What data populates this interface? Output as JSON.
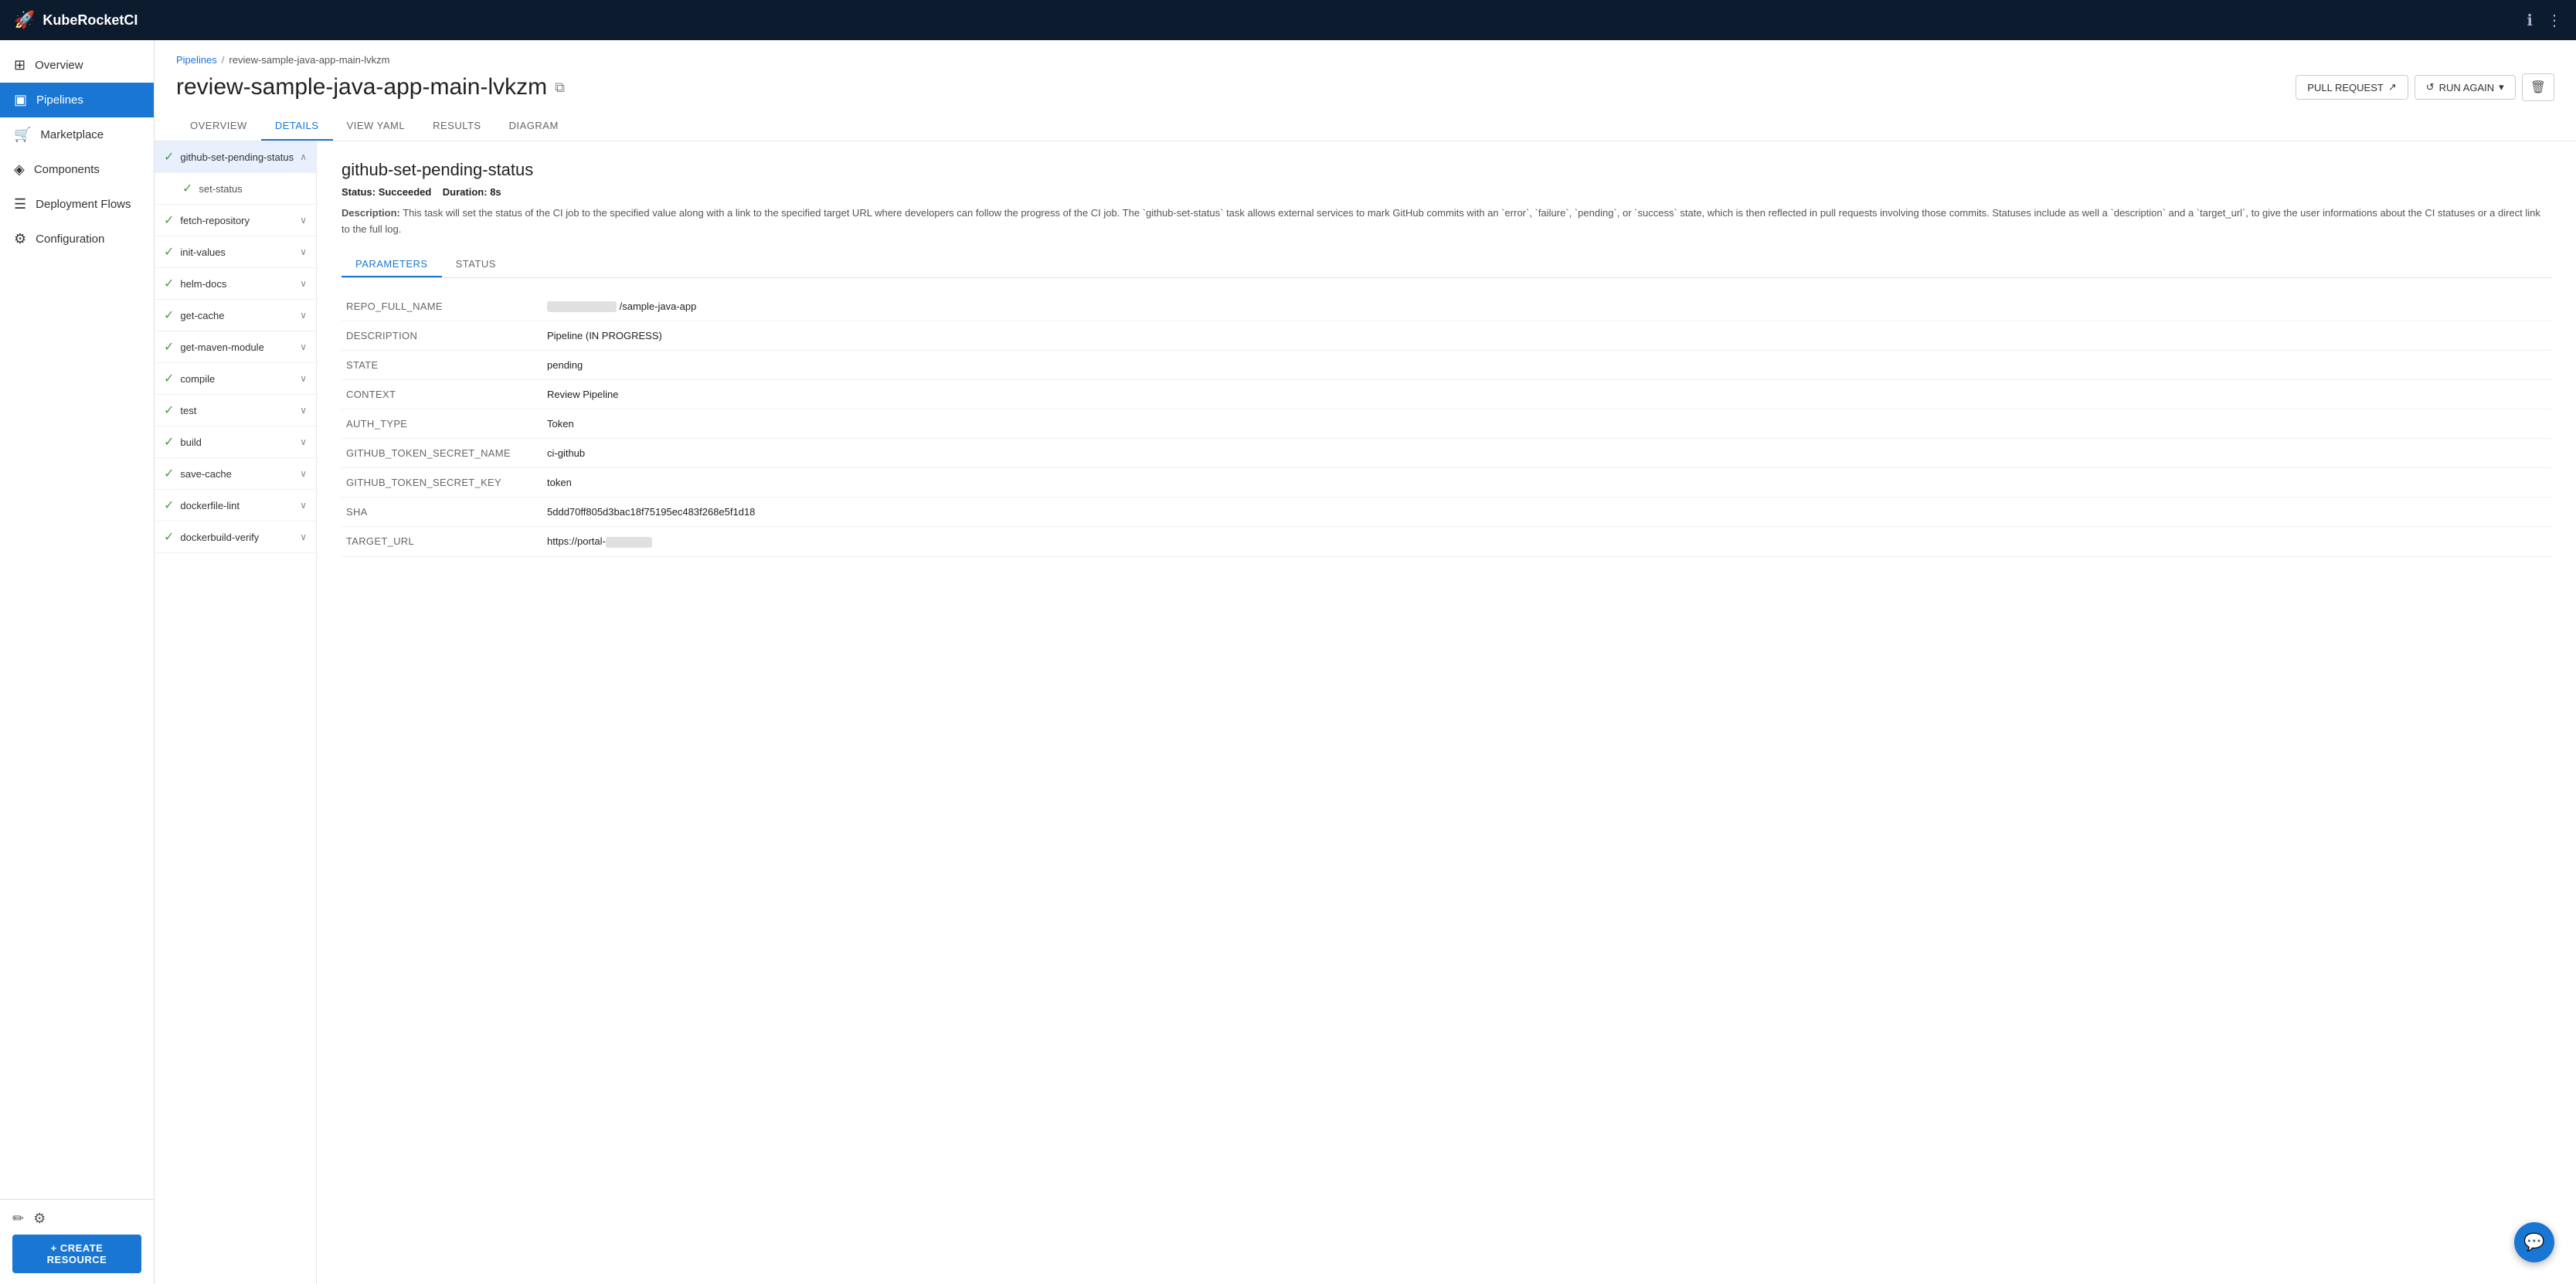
{
  "app": {
    "title": "KubeRocketCI",
    "logo": "🚀"
  },
  "topnav": {
    "info_icon": "ℹ",
    "more_icon": "⋮"
  },
  "sidebar": {
    "collapse_icon": "‹",
    "items": [
      {
        "id": "overview",
        "label": "Overview",
        "icon": "⊞"
      },
      {
        "id": "pipelines",
        "label": "Pipelines",
        "icon": "▣",
        "active": true
      },
      {
        "id": "marketplace",
        "label": "Marketplace",
        "icon": "🛒"
      },
      {
        "id": "components",
        "label": "Components",
        "icon": "◈"
      },
      {
        "id": "deployment-flows",
        "label": "Deployment Flows",
        "icon": "☰"
      },
      {
        "id": "configuration",
        "label": "Configuration",
        "icon": "⚙"
      }
    ],
    "bottom": {
      "edit_icon": "✏",
      "settings_icon": "⚙",
      "create_resource_label": "+ CREATE RESOURCE"
    }
  },
  "breadcrumb": {
    "link_text": "Pipelines",
    "separator": "/",
    "current": "review-sample-java-app-main-lvkzm"
  },
  "page": {
    "title": "review-sample-java-app-main-lvkzm",
    "copy_icon": "⧉",
    "actions": {
      "pull_request": "PULL REQUEST",
      "pull_request_icon": "↗",
      "run_again": "RUN AGAIN",
      "run_again_icon": "↺",
      "dropdown_icon": "▾",
      "delete_icon": "🗑"
    }
  },
  "tabs": [
    {
      "id": "overview",
      "label": "OVERVIEW"
    },
    {
      "id": "details",
      "label": "DETAILS",
      "active": true
    },
    {
      "id": "view-yaml",
      "label": "VIEW YAML"
    },
    {
      "id": "results",
      "label": "RESULTS"
    },
    {
      "id": "diagram",
      "label": "DIAGRAM"
    }
  ],
  "pipeline_steps": [
    {
      "id": "github-set-pending-status",
      "label": "github-set-pending-status",
      "status": "✓",
      "expanded": true,
      "selected": true,
      "has_chevron": true
    },
    {
      "id": "set-status",
      "label": "set-status",
      "status": "✓",
      "sub": true
    },
    {
      "id": "fetch-repository",
      "label": "fetch-repository",
      "status": "✓",
      "has_chevron": true
    },
    {
      "id": "init-values",
      "label": "init-values",
      "status": "✓",
      "has_chevron": true
    },
    {
      "id": "helm-docs",
      "label": "helm-docs",
      "status": "✓",
      "has_chevron": true
    },
    {
      "id": "get-cache",
      "label": "get-cache",
      "status": "✓",
      "has_chevron": true
    },
    {
      "id": "get-maven-module",
      "label": "get-maven-module",
      "status": "✓",
      "has_chevron": true
    },
    {
      "id": "compile",
      "label": "compile",
      "status": "✓",
      "has_chevron": true
    },
    {
      "id": "test",
      "label": "test",
      "status": "✓",
      "has_chevron": true
    },
    {
      "id": "build",
      "label": "build",
      "status": "✓",
      "has_chevron": true
    },
    {
      "id": "save-cache",
      "label": "save-cache",
      "status": "✓",
      "has_chevron": true
    },
    {
      "id": "dockerfile-lint",
      "label": "dockerfile-lint",
      "status": "✓",
      "has_chevron": true
    },
    {
      "id": "dockerbuild-verify",
      "label": "dockerbuild-verify",
      "status": "✓",
      "has_chevron": true
    }
  ],
  "detail": {
    "title": "github-set-pending-status",
    "status_label": "Status:",
    "status_value": "Succeeded",
    "duration_label": "Duration:",
    "duration_value": "8s",
    "description_label": "Description:",
    "description": "This task will set the status of the CI job to the specified value along with a link to the specified target URL where developers can follow the progress of the CI job. The `github-set-status` task allows external services to mark GitHub commits with an `error`, `failure`, `pending`, or `success` state, which is then reflected in pull requests involving those commits. Statuses include as well a `description` and a `target_url`, to give the user informations about the CI statuses or a direct link to the full log.",
    "inner_tabs": [
      {
        "id": "parameters",
        "label": "PARAMETERS",
        "active": true
      },
      {
        "id": "status",
        "label": "STATUS"
      }
    ],
    "parameters": [
      {
        "key": "REPO_FULL_NAME",
        "value": "/sample-java-app",
        "redacted": true
      },
      {
        "key": "DESCRIPTION",
        "value": "Pipeline (IN PROGRESS)",
        "redacted": false
      },
      {
        "key": "STATE",
        "value": "pending",
        "redacted": false
      },
      {
        "key": "CONTEXT",
        "value": "Review Pipeline",
        "redacted": false
      },
      {
        "key": "AUTH_TYPE",
        "value": "Token",
        "redacted": false
      },
      {
        "key": "GITHUB_TOKEN_SECRET_NAME",
        "value": "ci-github",
        "redacted": false
      },
      {
        "key": "GITHUB_TOKEN_SECRET_KEY",
        "value": "token",
        "redacted": false
      },
      {
        "key": "SHA",
        "value": "5ddd70ff805d3bac18f75195ec483f268e5f1d18",
        "redacted": false
      },
      {
        "key": "TARGET_URL",
        "value": "https://portal-",
        "redacted_suffix": true
      }
    ]
  },
  "fab": {
    "icon": "💬"
  }
}
